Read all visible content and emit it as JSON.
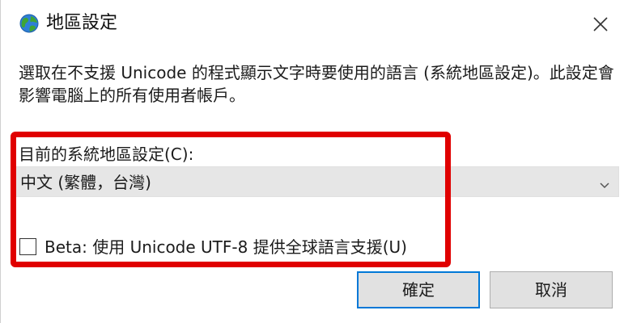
{
  "window": {
    "title": "地區設定",
    "icon": "globe-icon",
    "close_icon": "close-icon"
  },
  "description": "選取在不支援 Unicode 的程式顯示文字時要使用的語言 (系統地區設定)。此設定會影響電腦上的所有使用者帳戶。",
  "system_locale": {
    "label": "目前的系統地區設定(C):",
    "selected_value": "中文 (繁體，台灣)"
  },
  "beta": {
    "checked": false,
    "label": "Beta: 使用 Unicode UTF-8 提供全球語言支援(U)"
  },
  "buttons": {
    "ok_label": "確定",
    "cancel_label": "取消"
  },
  "colors": {
    "highlight": "#e00000",
    "accent": "#0078d7",
    "combo_background": "#e6e6e6",
    "button_background": "#e1e1e1"
  }
}
